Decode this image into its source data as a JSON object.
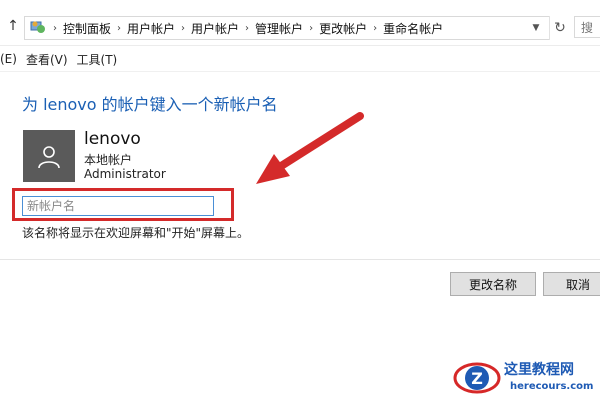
{
  "address_bar": {
    "breadcrumbs": [
      "控制面板",
      "用户帐户",
      "用户帐户",
      "管理帐户",
      "更改帐户",
      "重命名帐户"
    ],
    "search_placeholder": "搜"
  },
  "menu": {
    "items": [
      "(E)",
      "查看(V)",
      "工具(T)"
    ]
  },
  "page": {
    "title": "为 lenovo 的帐户键入一个新帐户名",
    "account": {
      "name": "lenovo",
      "type": "本地帐户",
      "role": "Administrator"
    },
    "input": {
      "placeholder": "新帐户名",
      "value": ""
    },
    "hint": "该名称将显示在欢迎屏幕和\"开始\"屏幕上。"
  },
  "buttons": {
    "rename": "更改名称",
    "cancel": "取消"
  },
  "watermark": {
    "title": "这里教程网",
    "url": "herecours.com"
  },
  "colors": {
    "title_blue": "#1a5fb4",
    "annotation_red": "#d42a2a",
    "avatar_gray": "#5a5a5a"
  },
  "icons": {
    "up": "up-arrow-icon",
    "location": "control-panel-icon",
    "refresh": "refresh-icon",
    "dropdown": "chevron-down-icon",
    "avatar": "user-silhouette-icon",
    "annotation": "red-arrow-annotation"
  }
}
